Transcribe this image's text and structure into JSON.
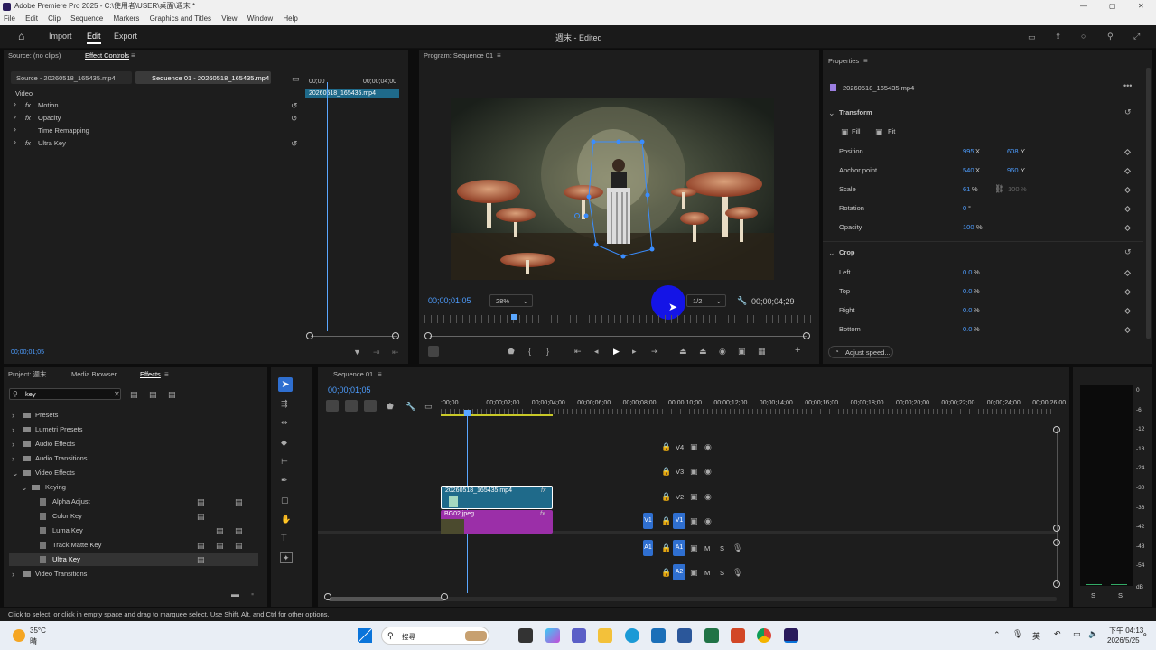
{
  "window": {
    "title": "Adobe Premiere Pro 2025 - C:\\使用者\\USER\\桌面\\週末 *",
    "controls": [
      "—",
      "▢",
      "✕"
    ]
  },
  "menu": [
    "File",
    "Edit",
    "Clip",
    "Sequence",
    "Markers",
    "Graphics and Titles",
    "View",
    "Window",
    "Help"
  ],
  "header": {
    "tabs": [
      "Import",
      "Edit",
      "Export"
    ],
    "active": "Edit",
    "project_title": "週末 - Edited"
  },
  "source_panel": {
    "tab_source": "Source: (no clips)",
    "tab_effect_controls": "Effect Controls",
    "clip_source": "Source - 20260518_165435.mp4",
    "clip_sequence": "Sequence 01 - 20260518_165435.mp4",
    "time_a": "00;00",
    "time_b": "00;00;04;00",
    "clip_bar": "20260518_165435.mp4",
    "section": "Video",
    "effects": [
      "Motion",
      "Opacity",
      "Time Remapping",
      "Ultra Key"
    ],
    "fx": "fx",
    "timecode": "00;00;01;05"
  },
  "program": {
    "title": "Program: Sequence 01",
    "timecode": "00;00;01;05",
    "zoom": "28%",
    "quality": "1/2",
    "duration": "00;00;04;29"
  },
  "properties": {
    "title": "Properties",
    "clip": "20260518_165435.mp4",
    "transform_label": "Transform",
    "fill": "Fill",
    "fit": "Fit",
    "rows": [
      {
        "label": "Position",
        "v1": "995",
        "u1": "X",
        "v2": "608",
        "u2": "Y"
      },
      {
        "label": "Anchor point",
        "v1": "540",
        "u1": "X",
        "v2": "960",
        "u2": "Y"
      },
      {
        "label": "Scale",
        "v1": "61",
        "u1": "%",
        "v2": "100",
        "u2": "%"
      },
      {
        "label": "Rotation",
        "v1": "0",
        "u1": "°",
        "v2": "",
        "u2": ""
      },
      {
        "label": "Opacity",
        "v1": "100",
        "u1": "%",
        "v2": "",
        "u2": ""
      }
    ],
    "crop_label": "Crop",
    "crop": [
      {
        "label": "Left",
        "value": "0.0",
        "unit": "%"
      },
      {
        "label": "Top",
        "value": "0.0",
        "unit": "%"
      },
      {
        "label": "Right",
        "value": "0.0",
        "unit": "%"
      },
      {
        "label": "Bottom",
        "value": "0.0",
        "unit": "%"
      }
    ],
    "adjust_speed": "Adjust speed..."
  },
  "project_panel": {
    "tab_project": "Project: 週末",
    "tab_media": "Media Browser",
    "tab_effects": "Effects",
    "search_value": "key",
    "tree": [
      "Presets",
      "Lumetri Presets",
      "Audio Effects",
      "Audio Transitions",
      "Video Effects",
      "Keying",
      "Alpha Adjust",
      "Color Key",
      "Luma Key",
      "Track Matte Key",
      "Ultra Key",
      "Video Transitions"
    ]
  },
  "timeline": {
    "title": "Sequence 01",
    "timecode": "00;00;01;05",
    "ruler": [
      ":00;00",
      "00;00;02;00",
      "00;00;04;00",
      "00;00;06;00",
      "00;00;08;00",
      "00;00;10;00",
      "00;00;12;00",
      "00;00;14;00",
      "00;00;16;00",
      "00;00;18;00",
      "00;00;20;00",
      "00;00;22;00",
      "00;00;24;00",
      "00;00;26;00"
    ],
    "tracks": [
      "V4",
      "V3",
      "V2",
      "V1",
      "A1",
      "A2"
    ],
    "clip_v2": "20260518_165435.mp4",
    "clip_v1": "BG02.jpeg",
    "fx": "fx",
    "src_v1": "V1",
    "src_a1": "A1",
    "m": "M",
    "s": "S"
  },
  "meter": {
    "scale": [
      "0",
      "-6",
      "-12",
      "-18",
      "-24",
      "-30",
      "-36",
      "-42",
      "-48",
      "-54"
    ],
    "db": "dB",
    "solo": [
      "S",
      "S"
    ]
  },
  "status_bar": "Click to select, or click in empty space and drag to marquee select. Use Shift, Alt, and Ctrl for other options.",
  "taskbar": {
    "temp": "35°C",
    "weather": "晴",
    "search": "搜尋",
    "ime": "英",
    "time": "下午 04:13",
    "date": "2026/5/25"
  },
  "colors": {
    "accent": "#2f6fd0",
    "clip_blue": "#1f6a8a",
    "clip_purple": "#9b2fa8",
    "playhead": "#5aa7ff"
  }
}
